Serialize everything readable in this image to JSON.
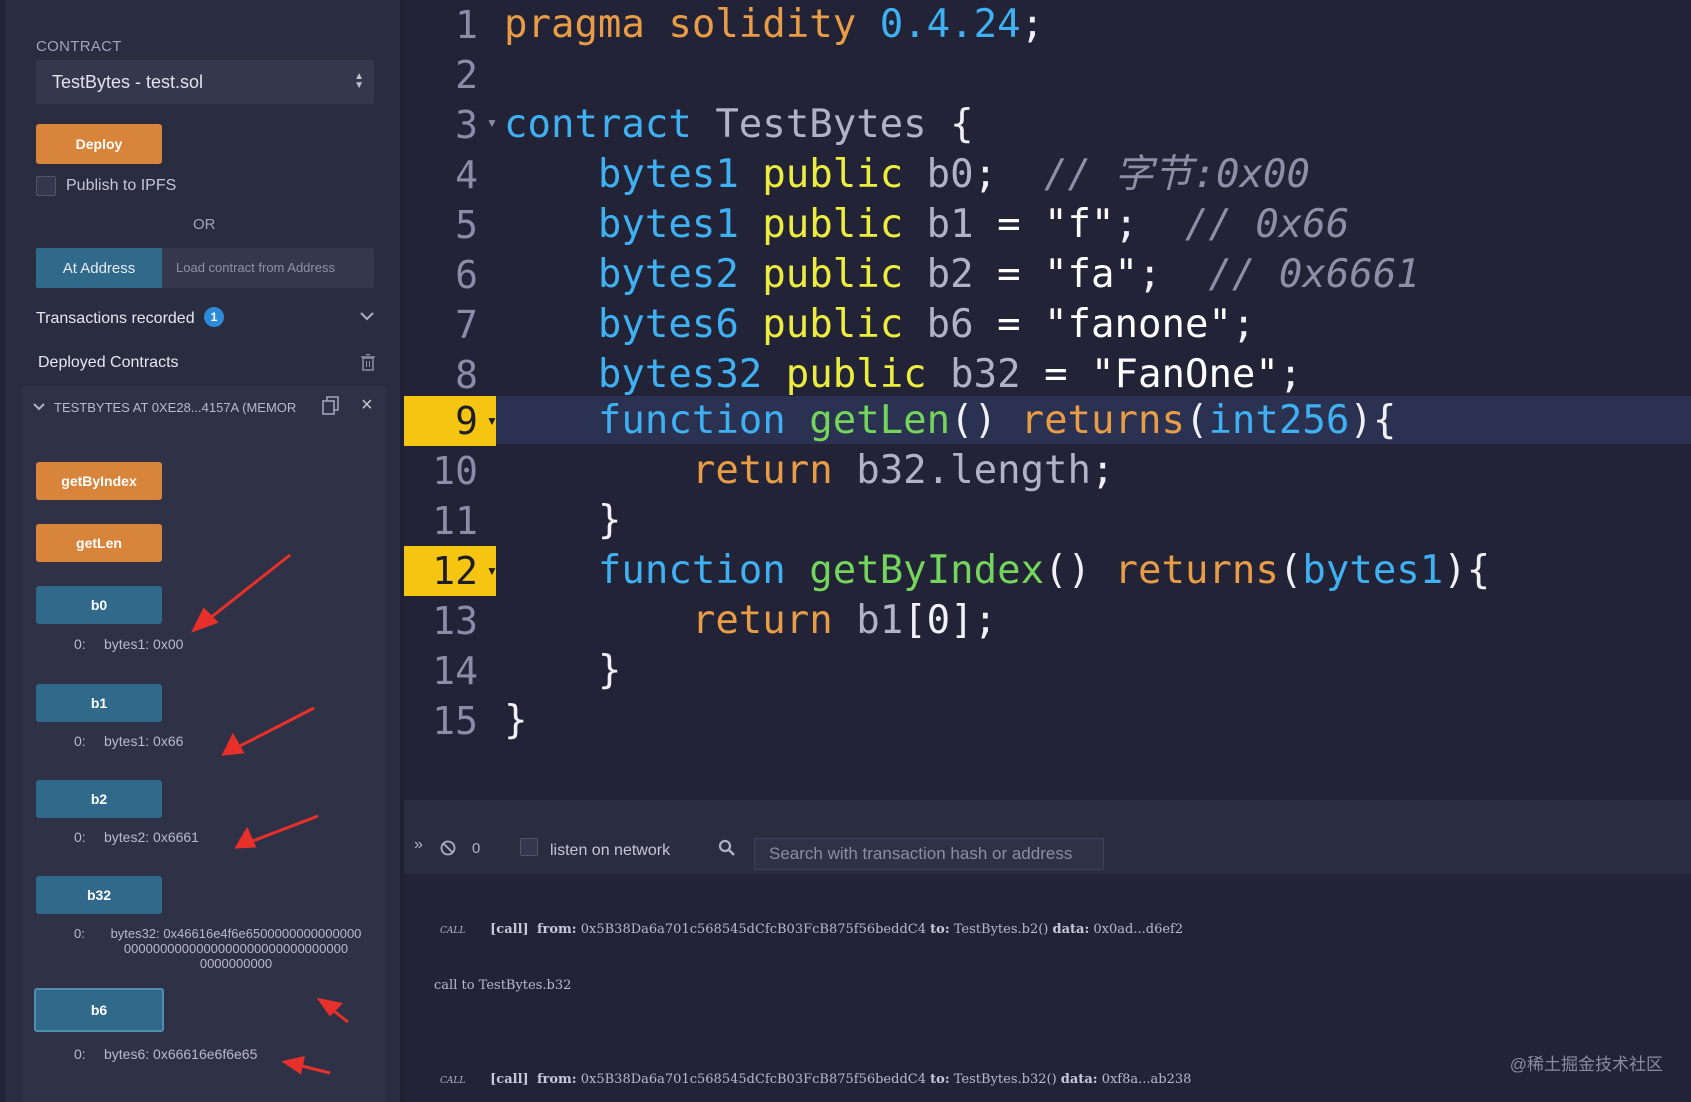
{
  "run_panel": {
    "contract_label": "CONTRACT",
    "contract_select": "TestBytes - test.sol",
    "deploy_label": "Deploy",
    "publish_label": "Publish to IPFS",
    "or_label": "OR",
    "at_address_label": "At Address",
    "at_address_placeholder": "Load contract from Address",
    "transactions_label": "Transactions recorded",
    "transactions_count": "1",
    "deployed_label": "Deployed Contracts",
    "instance_title": "TESTBYTES AT 0XE28...4157A (MEMOR",
    "functions": [
      {
        "label": "getByIndex",
        "color": "#d8843a"
      },
      {
        "label": "getLen",
        "color": "#d8843a"
      }
    ],
    "getters": [
      {
        "label": "b0",
        "index": "0:",
        "output": "bytes1: 0x00"
      },
      {
        "label": "b1",
        "index": "0:",
        "output": "bytes1: 0x66"
      },
      {
        "label": "b2",
        "index": "0:",
        "output": "bytes2: 0x6661"
      },
      {
        "label": "b32",
        "index": "0:",
        "output_lines": [
          "bytes32: 0x46616e4f6e6500000000000000",
          "0000000000000000000000000000000",
          "0000000000"
        ]
      },
      {
        "label": "b6",
        "index": "0:",
        "output": "bytes6: 0x66616e6f6e65"
      }
    ]
  },
  "editor": {
    "line_numbers": [
      "1",
      "2",
      "3",
      "4",
      "5",
      "6",
      "7",
      "8",
      "9",
      "10",
      "11",
      "12",
      "13",
      "14",
      "15"
    ],
    "breakpoints": [
      "9",
      "12"
    ],
    "code_lines": [
      "pragma solidity 0.4.24;",
      "",
      "contract TestBytes {",
      "    bytes1 public b0;  // 字节:0x00",
      "    bytes1 public b1 = \"f\";  // 0x66",
      "    bytes2 public b2 = \"fa\";  // 0x6661",
      "    bytes6 public b6 = \"fanone\";",
      "    bytes32 public b32 = \"FanOne\";",
      "    function getLen() returns(int256){",
      "        return b32.length;",
      "    }",
      "    function getByIndex() returns(bytes1){",
      "        return b1[0];",
      "    }",
      "}"
    ]
  },
  "terminal": {
    "pending_count": "0",
    "listen_label": "listen on network",
    "search_placeholder": "Search with transaction hash or address",
    "logs": [
      {
        "tag": "CALL",
        "kind": "[call]",
        "from_label": "from:",
        "from": "0x5B38Da6a701c568545dCfcB03FcB875f56beddC4",
        "to_label": "to:",
        "to": "TestBytes.b2()",
        "data_label": "data:",
        "data": "0x0ad...d6ef2"
      },
      {
        "text": "call to TestBytes.b32"
      },
      {
        "tag": "CALL",
        "kind": "[call]",
        "from_label": "from:",
        "from": "0x5B38Da6a701c568545dCfcB03FcB875f56beddC4",
        "to_label": "to:",
        "to": "TestBytes.b32()",
        "data_label": "data:",
        "data": "0xf8a...ab238"
      }
    ]
  },
  "watermark": "@稀土掘金技术社区"
}
